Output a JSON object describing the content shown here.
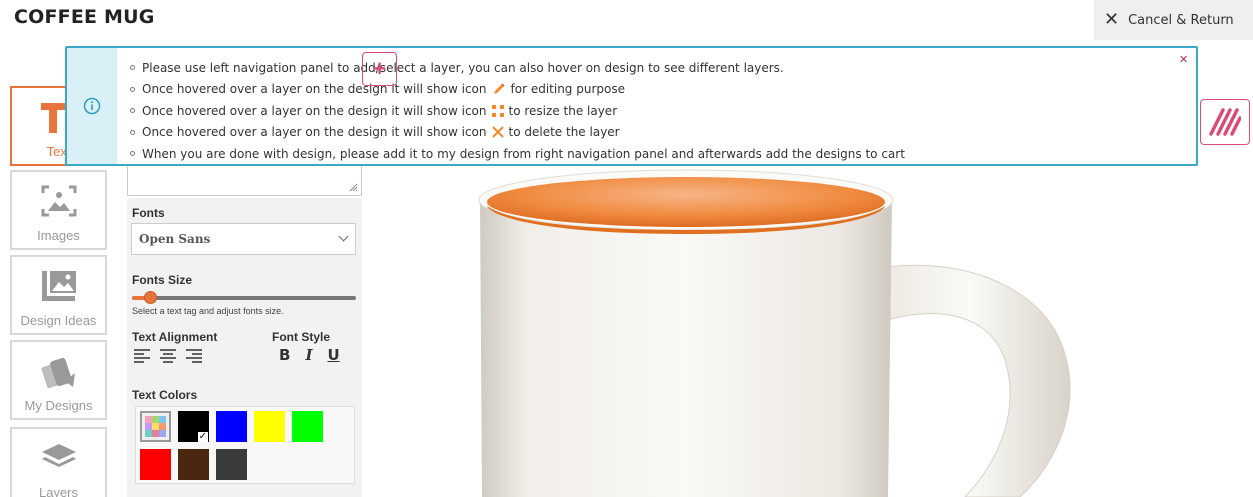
{
  "header": {
    "title": "COFFEE MUG",
    "cancel_label": "Cancel & Return"
  },
  "sidebar": {
    "items": [
      {
        "label": "Text",
        "icon": "text-icon",
        "active": true
      },
      {
        "label": "Images",
        "icon": "image-icon"
      },
      {
        "label": "Design Ideas",
        "icon": "gallery-icon"
      },
      {
        "label": "My Designs",
        "icon": "cards-icon"
      },
      {
        "label": "Layers",
        "icon": "layers-icon"
      }
    ]
  },
  "panel": {
    "fonts_label": "Fonts",
    "font_value": "Open Sans",
    "font_size_label": "Fonts Size",
    "font_size_level": 0.08,
    "font_size_hint": "Select a text tag and adjust fonts size.",
    "alignment_label": "Text Alignment",
    "font_style_label": "Font Style",
    "style_bold": "B",
    "style_italic": "I",
    "style_underline": "U",
    "colors_label": "Text Colors",
    "colors": [
      "#000000",
      "#0000ff",
      "#ffff00",
      "#00ff00",
      "#ff0000",
      "#4b2710",
      "#3a3a3a"
    ],
    "selected_color": "#000000"
  },
  "info": {
    "lines": [
      {
        "pre": "Please use left navigation panel to add/select a layer, you can also hover on design to see different layers.",
        "icon": null,
        "post": ""
      },
      {
        "pre": "Once hovered over a layer on the design it will show icon",
        "icon": "pencil-icon",
        "post": "for editing purpose"
      },
      {
        "pre": "Once hovered over a layer on the design it will show icon",
        "icon": "resize-icon",
        "post": "to resize the layer"
      },
      {
        "pre": "Once hovered over a layer on the design it will show icon",
        "icon": "delete-icon",
        "post": "to delete the layer"
      },
      {
        "pre": "When you are done with design, please add it to my design from right navigation panel and afterwards add the designs to cart",
        "icon": null,
        "post": ""
      }
    ],
    "accent": "#3aa8c6",
    "close": "×"
  },
  "add_layer": "+",
  "colors": {
    "accent": "#e8743c",
    "pink": "#d84d78"
  }
}
